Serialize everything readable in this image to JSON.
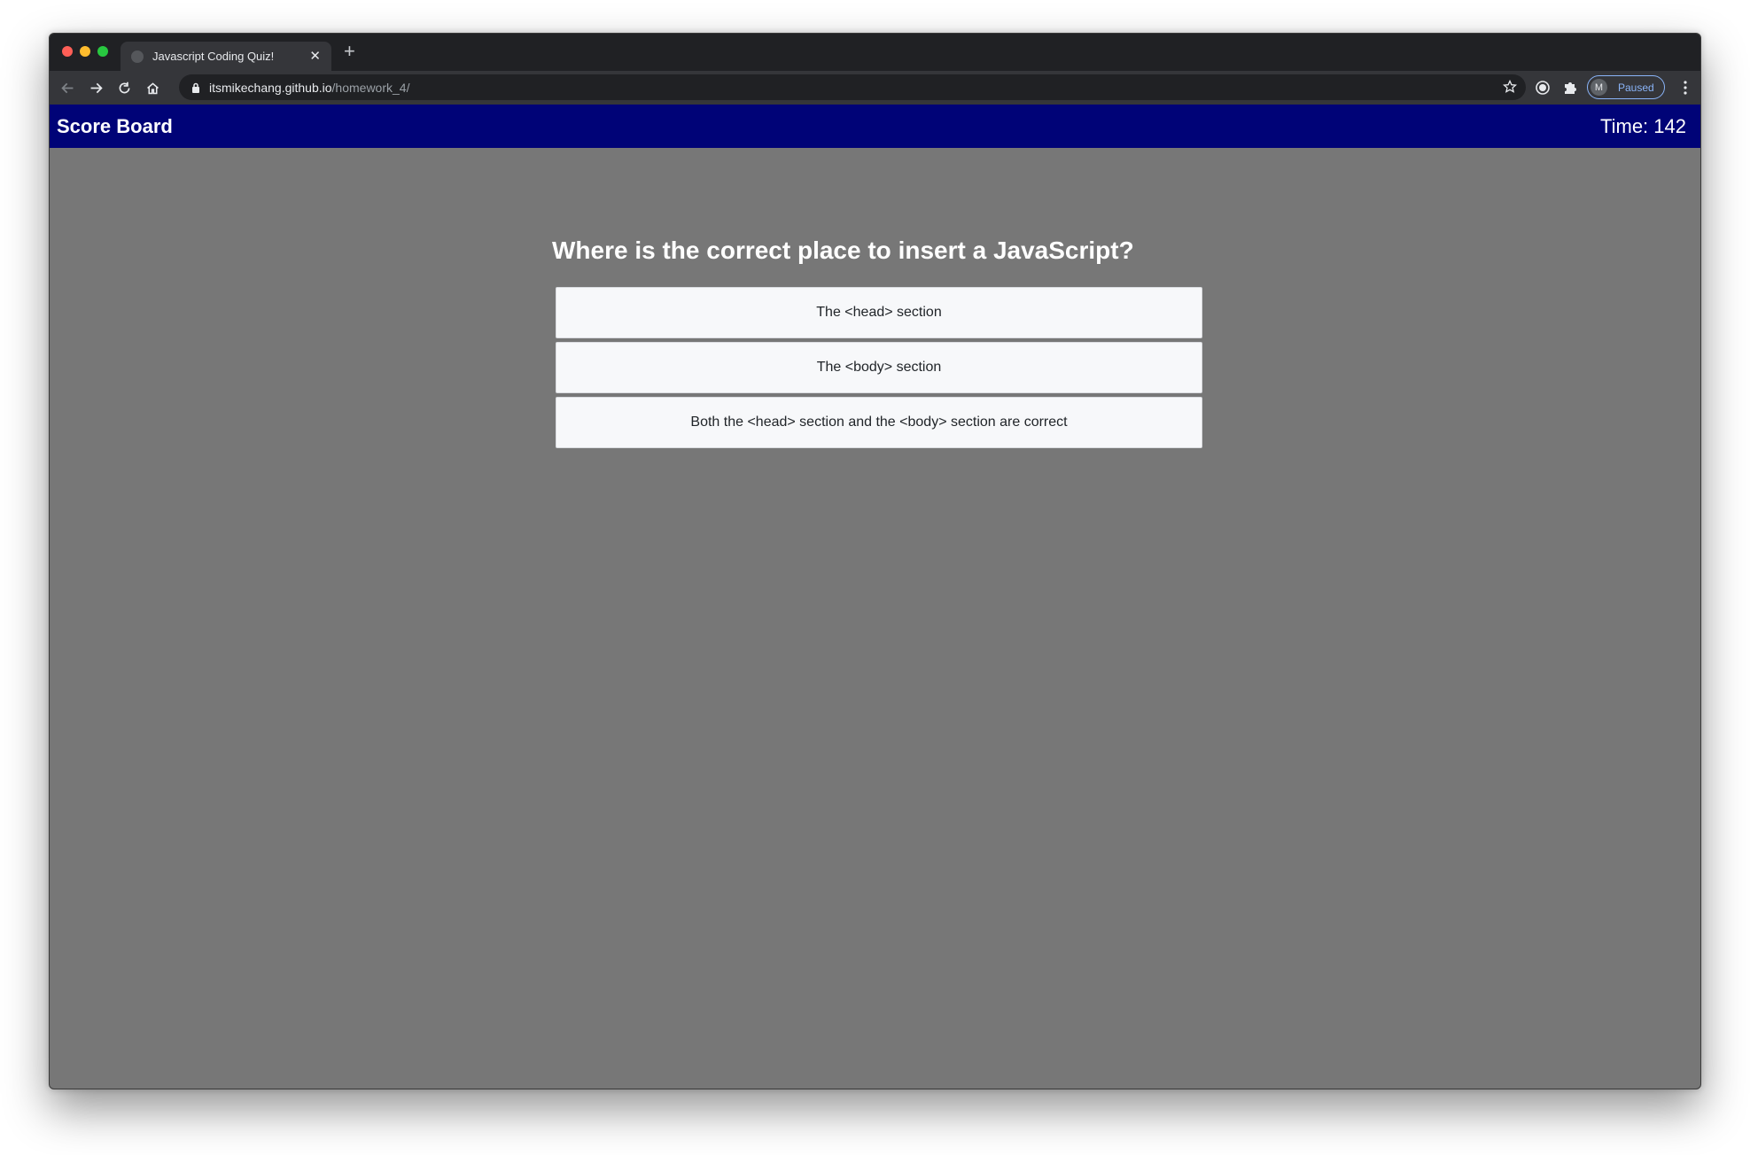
{
  "browser": {
    "tab_title": "Javascript Coding Quiz!",
    "tab_close": "✕",
    "new_tab": "+",
    "url_host": "itsmikechang.github.io",
    "url_path": "/homework_4/",
    "profile_initial": "M",
    "profile_status": "Paused",
    "icons": [
      "back-icon",
      "forward-icon",
      "reload-icon",
      "home-icon",
      "lock-icon",
      "star-icon",
      "extension-icon",
      "puzzle-icon",
      "menu-icon"
    ]
  },
  "header": {
    "scoreboard_label": "Score Board",
    "timer": "Time: 142",
    "background": "#000377"
  },
  "quiz": {
    "question": "Where is the correct place to insert a JavaScript?",
    "answers": [
      "The <head> section",
      "The <body> section",
      "Both the <head> section and the <body> section are correct"
    ],
    "background": "#777777"
  }
}
